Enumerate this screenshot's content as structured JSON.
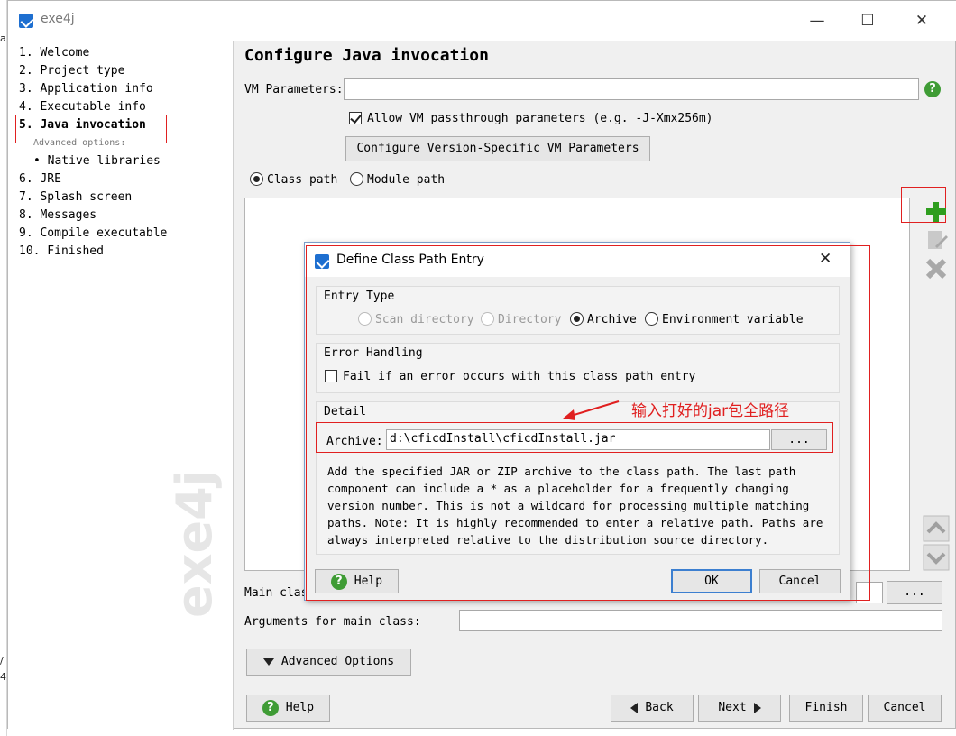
{
  "window": {
    "title": "exe4j",
    "minimize_label": "—",
    "maximize_label": "☐",
    "close_label": "✕"
  },
  "nav": {
    "items": [
      {
        "label": "1. Welcome"
      },
      {
        "label": "2. Project type"
      },
      {
        "label": "3. Application info"
      },
      {
        "label": "4. Executable info"
      },
      {
        "label": "5. Java invocation"
      },
      {
        "label": "6. JRE"
      },
      {
        "label": "7. Splash screen"
      },
      {
        "label": "8. Messages"
      },
      {
        "label": "9. Compile executable"
      },
      {
        "label": "10. Finished"
      }
    ],
    "advanced_options_label": "Advanced options:",
    "native_libraries_label": "• Native libraries",
    "watermark": "exe4j"
  },
  "page": {
    "title": "Configure Java invocation",
    "vm_parameters_label": "VM Parameters:",
    "vm_parameters_value": "",
    "allow_passthrough_label": "Allow VM passthrough parameters (e.g. -J-Xmx256m)",
    "configure_version_button": "Configure Version-Specific VM Parameters",
    "class_path_label": "Class path",
    "module_path_label": "Module path",
    "main_class_label": "Main clas",
    "main_class_browse": "...",
    "arguments_label": "Arguments for main class:",
    "advanced_options_button": "Advanced Options",
    "help_button": "Help",
    "back_button": "Back",
    "next_button": "Next",
    "finish_button": "Finish",
    "cancel_button": "Cancel"
  },
  "dialog": {
    "title": "Define Class Path Entry",
    "close_label": "✕",
    "entry_type_title": "Entry Type",
    "entry_types": [
      "Scan directory",
      "Directory",
      "Archive",
      "Environment variable"
    ],
    "selected_entry_type": "Archive",
    "error_handling_title": "Error Handling",
    "fail_on_error_label": "Fail if an error occurs with this class path entry",
    "detail_title": "Detail",
    "archive_label": "Archive:",
    "archive_value": "d:\\cficdInstall\\cficdInstall.jar",
    "browse_label": "...",
    "description": "Add the specified JAR or ZIP archive to the class path. The last path\ncomponent can include a * as a placeholder for a frequently changing\nversion number. This is not a wildcard for processing multiple matching\npaths. Note: It is highly recommended to enter a relative path. Paths are\nalways interpreted relative to the distribution source directory.",
    "help_button": "Help",
    "ok_button": "OK",
    "cancel_button": "Cancel"
  },
  "annotation": {
    "text": "输入打好的jar包全路径",
    "color": "#e02020"
  },
  "colors": {
    "accent": "#1e6fd0",
    "help_green": "#3f9c35",
    "add_green": "#2f9e1f",
    "highlight_red": "#e02020"
  },
  "icons": [
    "help-icon",
    "add-icon",
    "edit-icon",
    "delete-icon",
    "move-up-icon",
    "move-down-icon",
    "triangle-down-icon",
    "triangle-left-icon",
    "triangle-right-icon"
  ]
}
